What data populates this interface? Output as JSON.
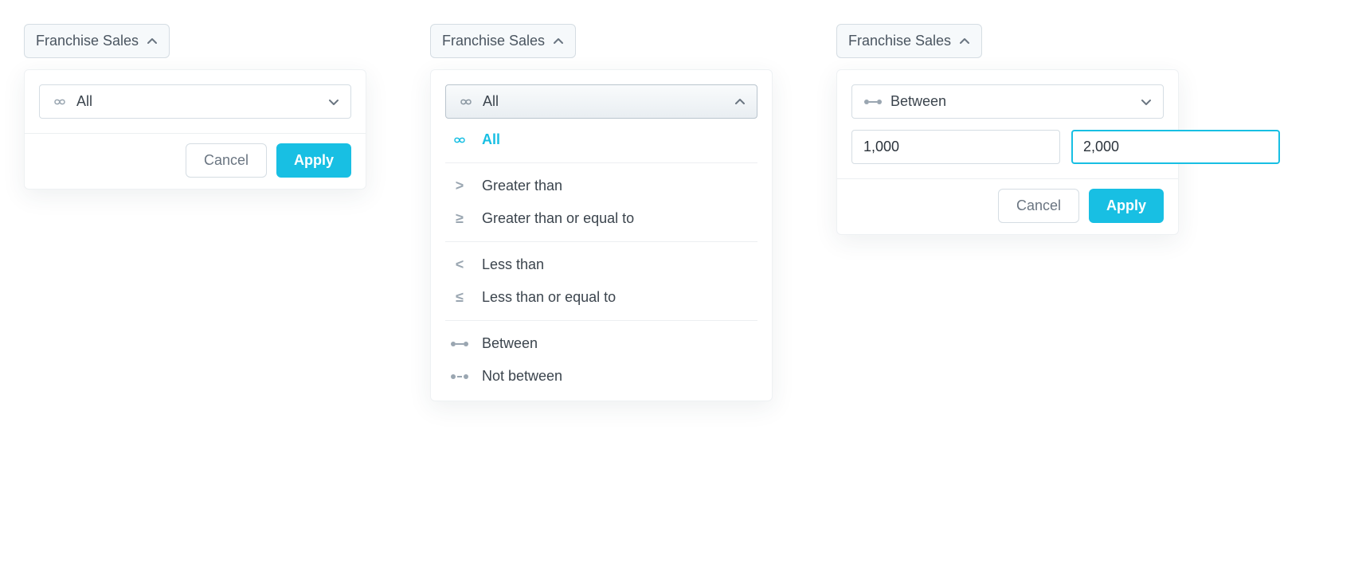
{
  "colors": {
    "accent": "#18bfe3",
    "muted": "#9aa6b1",
    "text": "#3b444d",
    "border": "#d5dde3"
  },
  "icons": {
    "infinity": "∞",
    "greater": ">",
    "greater_eq": "≥",
    "less": "<",
    "less_eq": "≤"
  },
  "state1": {
    "chip_label": "Franchise Sales",
    "select_label": "All",
    "cancel": "Cancel",
    "apply": "Apply"
  },
  "state2": {
    "chip_label": "Franchise Sales",
    "select_label": "All",
    "options": [
      {
        "key": "all",
        "label": "All",
        "sym_type": "infinity",
        "selected": true,
        "group": 0
      },
      {
        "key": "gt",
        "label": "Greater than",
        "sym_type": "gt",
        "selected": false,
        "group": 1
      },
      {
        "key": "gte",
        "label": "Greater than or equal to",
        "sym_type": "gte",
        "selected": false,
        "group": 1
      },
      {
        "key": "lt",
        "label": "Less than",
        "sym_type": "lt",
        "selected": false,
        "group": 2
      },
      {
        "key": "lte",
        "label": "Less than or equal to",
        "sym_type": "lte",
        "selected": false,
        "group": 2
      },
      {
        "key": "between",
        "label": "Between",
        "sym_type": "between",
        "selected": false,
        "group": 3
      },
      {
        "key": "not_between",
        "label": "Not between",
        "sym_type": "notbetween",
        "selected": false,
        "group": 3
      }
    ]
  },
  "state3": {
    "chip_label": "Franchise Sales",
    "select_label": "Between",
    "value_from": "1,000",
    "value_to": "2,000",
    "cancel": "Cancel",
    "apply": "Apply"
  }
}
